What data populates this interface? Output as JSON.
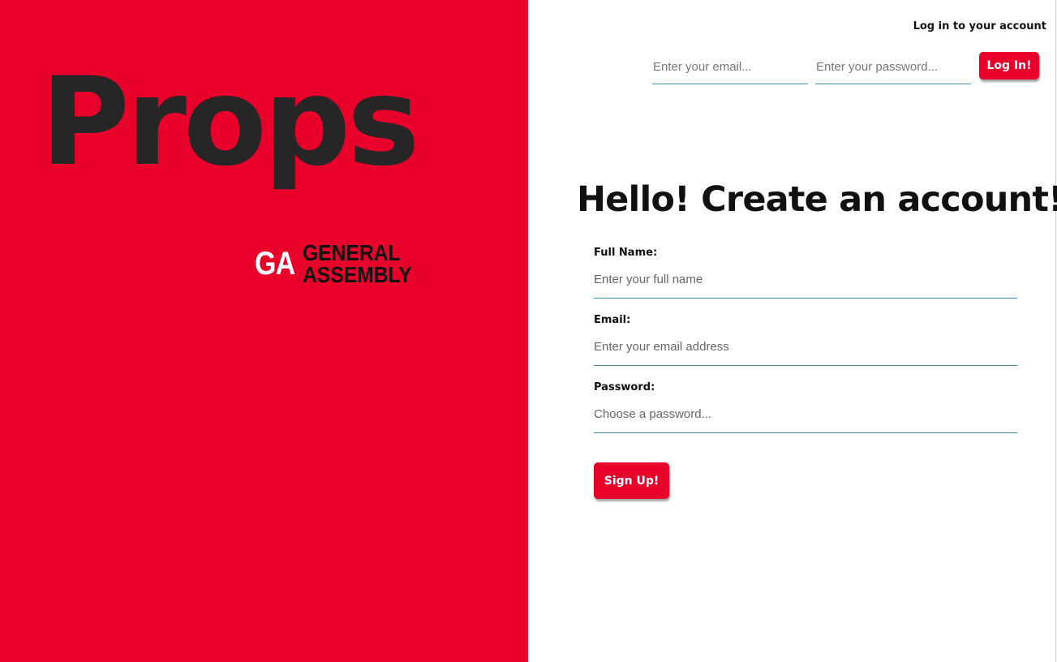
{
  "brand": {
    "title": "Props",
    "logo_mark": "GA",
    "logo_line1": "GENERAL",
    "logo_line2": "ASSEMBLY"
  },
  "login": {
    "heading": "Log in to your account",
    "email_placeholder": "Enter your email...",
    "password_placeholder": "Enter your password...",
    "button_label": "Log In!"
  },
  "signup": {
    "title": "Hello! Create an account!",
    "fields": [
      {
        "label": "Full Name:",
        "placeholder": "Enter your full name"
      },
      {
        "label": "Email:",
        "placeholder": "Enter your email address"
      },
      {
        "label": "Password:",
        "placeholder": "Choose a password..."
      }
    ],
    "button_label": "Sign Up!"
  },
  "colors": {
    "brand_red": "#e8002b",
    "title_dark": "#262626",
    "input_underline": "#3d8ea6"
  }
}
